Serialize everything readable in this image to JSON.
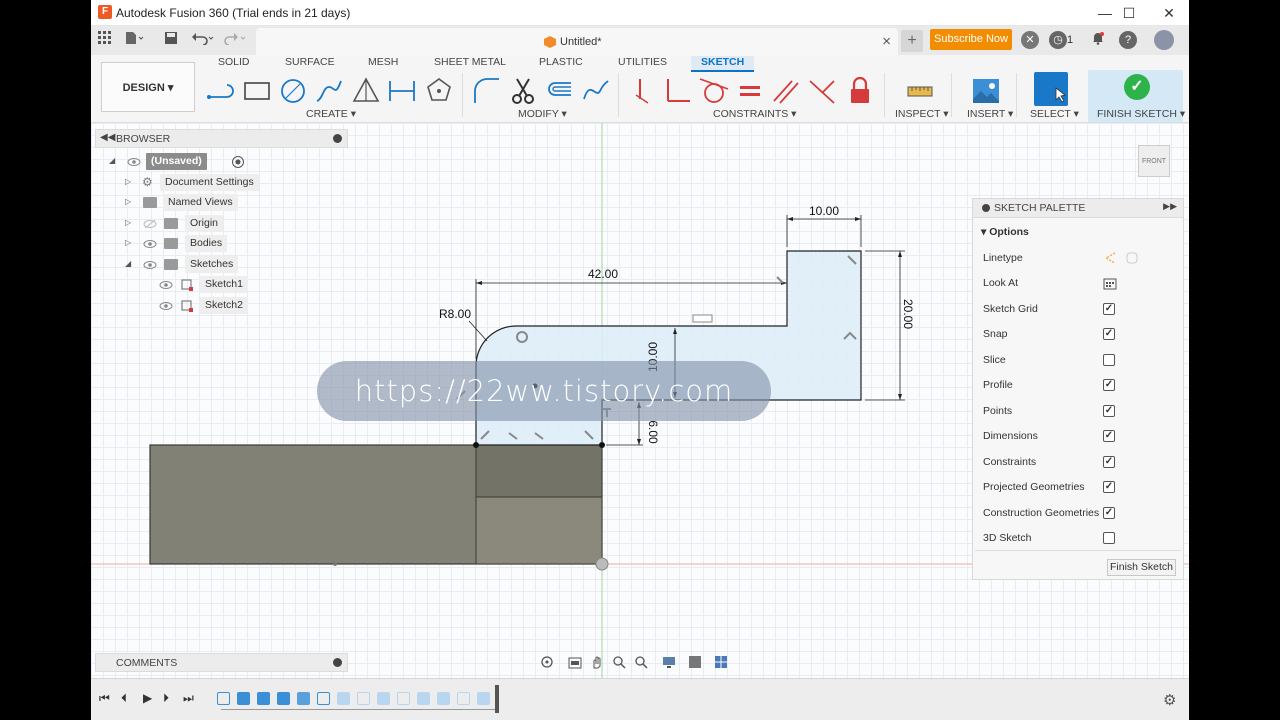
{
  "window": {
    "title": "Autodesk Fusion 360 (Trial ends in 21 days)",
    "app_icon": "F",
    "minimize": "—",
    "maximize": "☐",
    "close": "✕"
  },
  "tabbar": {
    "doc_tab_label": "Untitled*",
    "doc_tab_close": "×",
    "new_tab": "+",
    "subscribe_label": "Subscribe Now",
    "jobs_count": "1"
  },
  "ribbon": {
    "workspace": "DESIGN ▾",
    "tabs": [
      "SOLID",
      "SURFACE",
      "MESH",
      "SHEET METAL",
      "PLASTIC",
      "UTILITIES",
      "SKETCH"
    ],
    "active_tab": "SKETCH",
    "groups": {
      "create": "CREATE ▾",
      "modify": "MODIFY ▾",
      "constraints": "CONSTRAINTS ▾",
      "inspect": "INSPECT ▾",
      "insert": "INSERT ▾",
      "select": "SELECT ▾",
      "finish": "FINISH SKETCH ▾"
    }
  },
  "browser": {
    "title": "BROWSER",
    "root": "(Unsaved)",
    "items": [
      {
        "label": "Document Settings"
      },
      {
        "label": "Named Views"
      },
      {
        "label": "Origin"
      },
      {
        "label": "Bodies"
      },
      {
        "label": "Sketches"
      },
      {
        "label": "Sketch1"
      },
      {
        "label": "Sketch2"
      }
    ]
  },
  "sketch_palette": {
    "title": "SKETCH PALETTE",
    "options_label": "Options",
    "rows": [
      {
        "label": "Linetype",
        "kind": "icon"
      },
      {
        "label": "Look At",
        "kind": "icon"
      },
      {
        "label": "Sketch Grid",
        "checked": true
      },
      {
        "label": "Snap",
        "checked": true
      },
      {
        "label": "Slice",
        "checked": false
      },
      {
        "label": "Profile",
        "checked": true
      },
      {
        "label": "Points",
        "checked": true
      },
      {
        "label": "Dimensions",
        "checked": true
      },
      {
        "label": "Constraints",
        "checked": true
      },
      {
        "label": "Projected Geometries",
        "checked": true
      },
      {
        "label": "Construction Geometries",
        "checked": true
      },
      {
        "label": "3D Sketch",
        "checked": false
      }
    ],
    "check_mark": "✓",
    "finish_button": "Finish Sketch"
  },
  "viewcube": {
    "face": "FRONT"
  },
  "comments": {
    "title": "COMMENTS"
  },
  "sketch": {
    "dimensions": {
      "top_width": "10.00",
      "overall_width": "42.00",
      "right_height": "20.00",
      "fillet_radius": "R8.00",
      "middle_height": "10.00",
      "bottom_height": "6.00"
    }
  },
  "watermark": "https://22ww.tistory.com",
  "colors": {
    "accent": "#0b74c6",
    "subscribe": "#f28c00",
    "finish_check": "#2db34a",
    "profile_fill": "#dcecf8",
    "body": "#7f7e72",
    "red_constraint": "#d63b3b"
  }
}
